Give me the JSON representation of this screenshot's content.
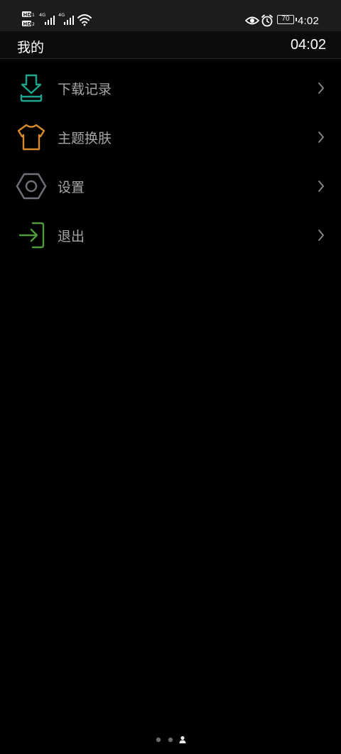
{
  "status_bar": {
    "time": "4:02",
    "battery": "70",
    "sim1_label": "HD",
    "sim2_label": "HD",
    "network1": "4G",
    "network2": "4G",
    "icons": [
      "hd-icon",
      "signal-icon",
      "wifi-icon",
      "eye-icon",
      "alarm-icon",
      "battery-icon"
    ]
  },
  "header": {
    "title": "我的",
    "time": "04:02"
  },
  "menu": {
    "items": [
      {
        "label": "下载记录",
        "icon": "download-record-icon",
        "color": "#1fa58e"
      },
      {
        "label": "主题换肤",
        "icon": "theme-shirt-icon",
        "color": "#d88a2c"
      },
      {
        "label": "设置",
        "icon": "settings-hexagon-icon",
        "color": "#6f7278"
      },
      {
        "label": "退出",
        "icon": "logout-icon",
        "color": "#4e9a3c"
      }
    ],
    "chevron_icon": "chevron-right-icon"
  },
  "page_indicator": {
    "total": 3,
    "current": 3
  },
  "colors": {
    "background": "#000000",
    "status_bar": "#1b1c1e",
    "label": "#a6a6a6",
    "chevron": "#8a8a8a"
  }
}
